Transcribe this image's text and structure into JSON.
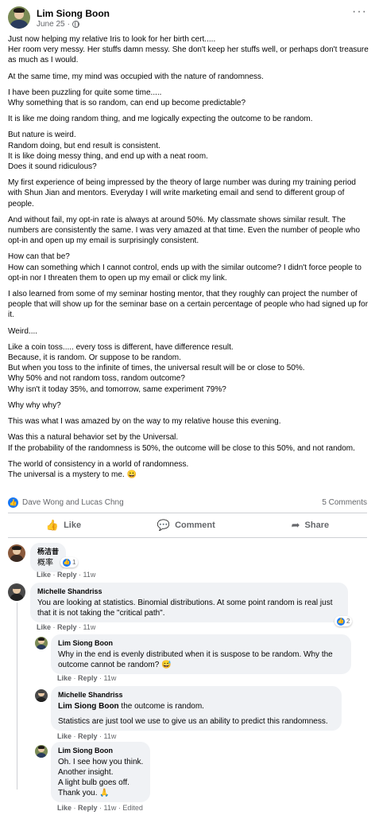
{
  "post": {
    "author": "Lim Siong Boon",
    "date": "June 25",
    "more_icon": "more-horizontal-icon",
    "paragraphs": [
      "Just now helping my relative Iris to look for her birth cert.....\nHer room very messy. Her stuffs damn messy. She don't keep her stuffs well, or perhaps don't treasure as much as I would.",
      "At the same time, my mind was occupied with the nature of randomness.",
      "I have been puzzling for quite some time.....\nWhy something that is so random, can end up become predictable?",
      "It is like me doing random thing, and me logically expecting the outcome to be random.",
      "But nature is weird.\nRandom doing, but end result is consistent.\nIt is like doing messy thing, and end up with a neat room.\nDoes it sound ridiculous?",
      "My first experience of being impressed by the theory of large number was during my training period with Shun Jian and mentors. Everyday I will write marketing email and send to different group of people.",
      "And without fail, my opt-in rate is always at around 50%. My classmate shows similar result. The numbers are consistently the same. I was very amazed at that time. Even the number of people who opt-in and open up my email is surprisingly consistent.",
      "How can that be?\nHow can something which I cannot control, ends up with the similar outcome? I didn't force people to opt-in nor I threaten them to open up my email or click my link.",
      "I also learned from some of my seminar hosting mentor, that they roughly can project the number of people that will show up for the seminar base on a certain percentage of people who had signed up for it.",
      "Weird....",
      "Like a coin toss..... every toss is different, have difference result.\nBecause, it is random. Or suppose to be random.\nBut when you toss to the infinite of times, the universal result will be or close to 50%.\nWhy 50% and not random toss, random outcome?\nWhy isn't it today 35%, and tomorrow, same experiment 79%?",
      "Why why why?",
      "This was what I was amazed by on the way to my relative house this evening.",
      "Was this a natural behavior set by the Universal.\nIf the probability of the randomness is 50%, the outcome will be close to this 50%, and not random.",
      "The world of consistency in a world of randomness.\nThe universal is a mystery to me. 😀"
    ],
    "reactions": "Dave Wong and Lucas Chng",
    "comments_count": "5 Comments"
  },
  "actions": {
    "like": "Like",
    "comment": "Comment",
    "share": "Share"
  },
  "comments": [
    {
      "name": "杨洁昔",
      "text": "概率",
      "reaction_count": "1",
      "like": "Like",
      "reply": "Reply",
      "time": "11w"
    },
    {
      "name": "Michelle Shandriss",
      "text": "You are looking at statistics. Binomial distributions. At some point random is real just that it is not taking the \"critical path\".",
      "reaction_count": "2",
      "like": "Like",
      "reply": "Reply",
      "time": "11w"
    }
  ],
  "replies": [
    {
      "name": "Lim Siong Boon",
      "text": "Why in the end is evenly distributed when it is suspose to be random. Why the outcome cannot be random? 😅",
      "like": "Like",
      "reply": "Reply",
      "time": "11w"
    },
    {
      "name": "Michelle Shandriss",
      "tag": "Lim Siong Boon",
      "text": " the outcome is random.",
      "text2": "Statistics are just tool we use to give us an ability to predict this randomness.",
      "like": "Like",
      "reply": "Reply",
      "time": "11w"
    },
    {
      "name": "Lim Siong Boon",
      "text": "Oh. I see how you think.\nAnother insight.\nA light bulb goes off.\nThank you. 🙏",
      "like": "Like",
      "reply": "Reply",
      "time": "11w",
      "edited": "Edited"
    }
  ]
}
